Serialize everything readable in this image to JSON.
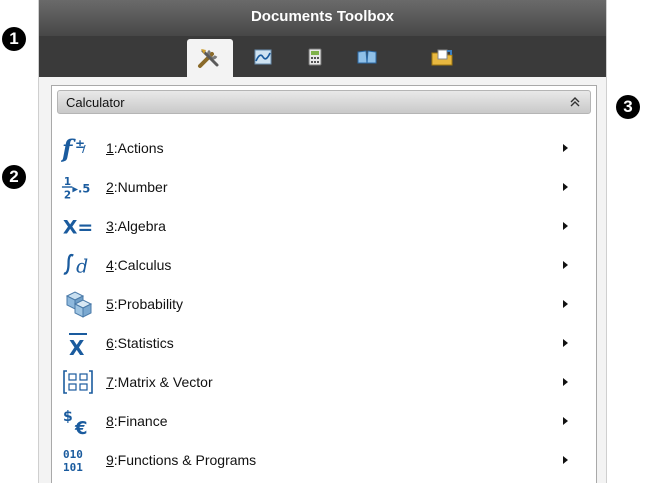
{
  "callouts": [
    "1",
    "2",
    "3"
  ],
  "toolbox": {
    "title": "Documents Toolbox",
    "tabs": [
      {
        "name": "tools",
        "active": true
      },
      {
        "name": "graphs",
        "active": false
      },
      {
        "name": "calculator",
        "active": false
      },
      {
        "name": "library",
        "active": false
      },
      {
        "name": "documents",
        "active": false
      }
    ]
  },
  "panel": {
    "title": "Calculator",
    "collapse_glyph": "≈"
  },
  "menu": [
    {
      "key": "1",
      "label": ":Actions",
      "icon": "actions-icon"
    },
    {
      "key": "2",
      "label": ":Number",
      "icon": "number-icon"
    },
    {
      "key": "3",
      "label": ":Algebra",
      "icon": "algebra-icon"
    },
    {
      "key": "4",
      "label": ":Calculus",
      "icon": "calculus-icon"
    },
    {
      "key": "5",
      "label": ":Probability",
      "icon": "probability-icon"
    },
    {
      "key": "6",
      "label": ":Statistics",
      "icon": "statistics-icon"
    },
    {
      "key": "7",
      "label": ":Matrix & Vector",
      "icon": "matrix-vector-icon"
    },
    {
      "key": "8",
      "label": ":Finance",
      "icon": "finance-icon"
    },
    {
      "key": "9",
      "label": ":Functions & Programs",
      "icon": "functions-programs-icon"
    }
  ],
  "icon_text": {
    "number_frac_top": "1",
    "number_frac_bottom": "2",
    "number_arrow": "▸.5",
    "algebra": "X=",
    "statistics": "X",
    "finance_dollar": "$",
    "finance_euro": "€",
    "binary_top": "010",
    "binary_bottom": "101"
  },
  "colors": {
    "accent_blue": "#1a5b9e",
    "title_bar": "#474747"
  }
}
